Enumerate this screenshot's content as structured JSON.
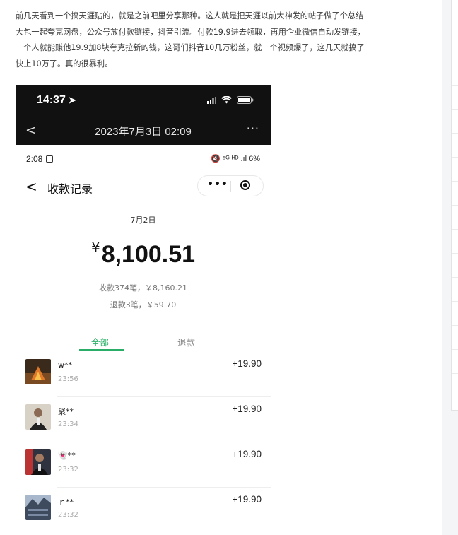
{
  "article": {
    "lines": [
      "前几天看到一个搞天涯贴的，就是之前吧里分享那种。这人就是把天涯以前大神发的帖子做了个总结",
      "大包一起夸克网盘，公众号放付款链接，抖音引流。付款19.9进去领取，再用企业微信自动发链接，",
      "一个人就能赚他19.9加8块夸克拉新的钱，这哥们抖音10几万粉丝，就一个视频爆了，这几天就搞了",
      "快上10万了。真的很暴利。"
    ]
  },
  "screenshot": {
    "ios_status": {
      "time": "14:37"
    },
    "wechat_nav": {
      "back": "<",
      "title": "2023年7月3日 02:09",
      "more": "···"
    },
    "android_status": {
      "time": "2:08",
      "right": "🔇 ⁵ᴳ ᴴᴰ .ıl 6%"
    },
    "page": {
      "back": "<",
      "title": "收款记录",
      "date": "7月2日",
      "currency": "¥",
      "amount": "8,100.51",
      "received_summary": "收款374笔，￥8,160.21",
      "refund_summary": "退款3笔，￥59.70",
      "tabs": [
        "全部",
        "退款"
      ]
    },
    "transactions": [
      {
        "name": "w**",
        "time": "23:56",
        "amount": "+19.90",
        "avatar_color": "#6b4a2a"
      },
      {
        "name": "聚**",
        "time": "23:34",
        "amount": "+19.90",
        "avatar_color": "#c9c2b5"
      },
      {
        "name": "👻**",
        "time": "23:32",
        "amount": "+19.90",
        "avatar_color": "#3d4250"
      },
      {
        "name": "ｒ**",
        "time": "23:32",
        "amount": "+19.90",
        "avatar_color": "#4c5970"
      }
    ]
  },
  "colors": {
    "accent_green": "#2aae67",
    "dark_bar": "#111111"
  }
}
